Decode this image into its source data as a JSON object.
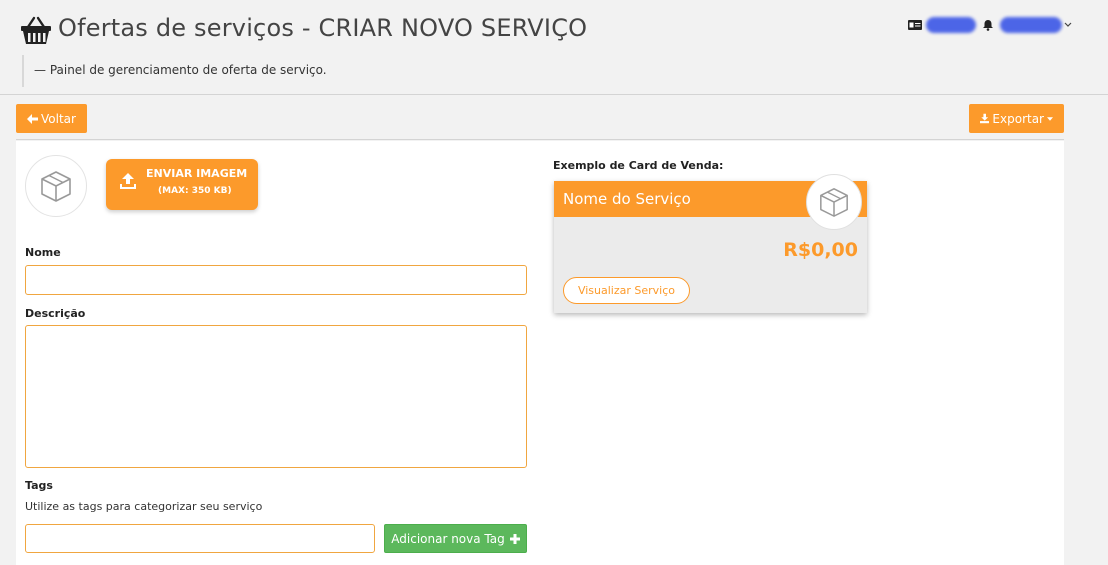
{
  "header": {
    "title": "Ofertas de serviços - CRIAR NOVO SERVIÇO",
    "subtitle": "— Painel de gerenciamento de oferta de serviço."
  },
  "toolbar": {
    "back_label": "Voltar",
    "export_label": "Exportar"
  },
  "upload": {
    "label_line1": "ENVIAR IMAGEM",
    "label_line2": "(MAX: 350 KB)"
  },
  "form": {
    "name_label": "Nome",
    "name_value": "",
    "description_label": "Descrição",
    "description_value": "",
    "tags_label": "Tags",
    "tags_help": "Utilize as tags para categorizar seu serviço",
    "tag_value": "",
    "add_tag_label": "Adicionar nova Tag"
  },
  "card_preview": {
    "heading": "Exemplo de Card de Venda:",
    "name": "Nome do Serviço",
    "price": "R$0,00",
    "view_button": "Visualizar Serviço"
  },
  "colors": {
    "accent": "#fc9a2b",
    "success": "#5cb85c",
    "background": "#f2f2f2"
  }
}
